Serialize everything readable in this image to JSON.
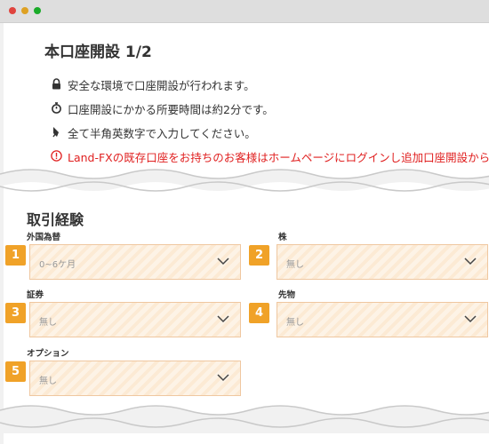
{
  "window": {
    "controls": [
      "close",
      "minimize",
      "zoom"
    ]
  },
  "page": {
    "title": "本口座開設 1/2",
    "notes": [
      {
        "icon": "lock-icon",
        "text": "安全な環境で口座開設が行われます。"
      },
      {
        "icon": "stopwatch-icon",
        "text": "口座開設にかかる所要時間は約2分です。"
      },
      {
        "icon": "pen-icon",
        "text": "全て半角英数字で入力してください。"
      },
      {
        "icon": "alert-icon",
        "text": "Land-FXの既存口座をお持ちのお客様はホームページにログインし追加口座開設から開設して"
      }
    ]
  },
  "section": {
    "title": "取引経験",
    "fields": [
      {
        "num": "1",
        "label": "外国為替",
        "value": "0~6ケ月"
      },
      {
        "num": "2",
        "label": "株",
        "value": "無し"
      },
      {
        "num": "3",
        "label": "証券",
        "value": "無し"
      },
      {
        "num": "4",
        "label": "先物",
        "value": "無し"
      },
      {
        "num": "5",
        "label": "オプション",
        "value": "無し"
      }
    ]
  },
  "colors": {
    "accent": "#f0a228",
    "warning": "#e02020",
    "select_border": "#efc7a0"
  }
}
